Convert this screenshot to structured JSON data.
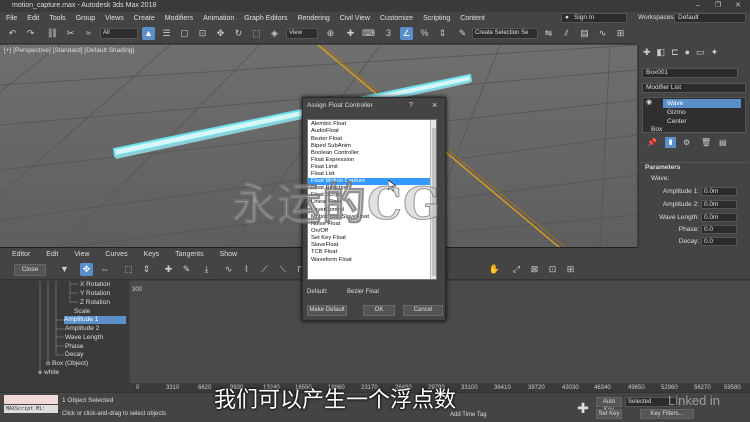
{
  "window": {
    "title": "motion_capture.max - Autodesk 3ds Max 2018"
  },
  "menu": [
    "File",
    "Edit",
    "Tools",
    "Group",
    "Views",
    "Create",
    "Modifiers",
    "Animation",
    "Graph Editors",
    "Rendering",
    "Civil View",
    "Customize",
    "Scripting",
    "Content"
  ],
  "account": {
    "sign_in": "Sign In",
    "workspaces_label": "Workspaces:",
    "workspace_value": "Default"
  },
  "toolbar": {
    "filter_value": "All",
    "ref_coord": "View",
    "selection_set": "Create Selection Se"
  },
  "viewport": {
    "label": "[+] [Perspective] [Standard] [Default Shading]"
  },
  "command_panel": {
    "object_name": "Box001",
    "modifier_list": "Modifier List",
    "stack": [
      "Wave",
      "Gizmo",
      "Center",
      "Box"
    ],
    "rollout_title": "Parameters",
    "group_label": "Wave:",
    "params": [
      {
        "label": "Amplitude 1:",
        "value": "0.0m"
      },
      {
        "label": "Amplitude 2:",
        "value": "0.0m"
      },
      {
        "label": "Wave Length:",
        "value": "0.0m"
      },
      {
        "label": "Phase:",
        "value": "0.0"
      },
      {
        "label": "Decay:",
        "value": "0.0"
      }
    ]
  },
  "curve_editor": {
    "menu": [
      "Editor",
      "Edit",
      "View",
      "Curves",
      "Keys",
      "Tangents",
      "Show"
    ],
    "close_label": "Close",
    "tree": [
      "X Rotation",
      "Y Rotation",
      "Z Rotation",
      "Scale",
      "Amplitude 1",
      "Amplitude 2",
      "Wave Length",
      "Phase",
      "Decay",
      "Box (Object)",
      "white"
    ],
    "graph_value_label": "300",
    "ruler": [
      "0",
      "3310",
      "6620",
      "9930",
      "13240",
      "16550",
      "19860",
      "23170",
      "26480",
      "29790",
      "33100",
      "36410",
      "39720",
      "43030",
      "46340",
      "49650",
      "52960",
      "56270",
      "59580"
    ]
  },
  "status": {
    "maxscript": "MAXScript Mi:",
    "selected": "1 Object Selected",
    "hint": "Click or click-and-drag to select objects",
    "add_time_tag": "Add Time Tag",
    "auto_key": "Auto Key",
    "set_key": "Set Key",
    "selected_dropdown": "Selected",
    "key_filters": "Key Filters..."
  },
  "dialog": {
    "title": "Assign Float Controller",
    "help": "?",
    "items": [
      "Alembic Float",
      "AudioFloat",
      "Bezier Float",
      "Biped SubAnim",
      "Boolean Controller",
      "Float Expression",
      "Float Limit",
      "Float List",
      "Float Motion Capture",
      "Float Reaction",
      "Float Script",
      "Linear Float",
      "LayerControl",
      "Motion Clip SlaveFloat",
      "Noise Float",
      "On/Off",
      "Set Key Float",
      "SlaveFloat",
      "TCB Float",
      "Waveform Float"
    ],
    "selected_index": 8,
    "default_label": "Default:",
    "default_value": "Bezier Float",
    "make_default": "Make Default",
    "ok": "OK",
    "cancel": "Cancel"
  },
  "overlay": {
    "watermark": "永运的CG",
    "subtitle": "我们可以产生一个浮点数",
    "brand": "Linked in"
  },
  "colors": {
    "accent": "#5a8fc9",
    "list_selection": "#3399ff",
    "object_highlight": "#8ee8f0",
    "grid_axis": "#d8a020"
  }
}
